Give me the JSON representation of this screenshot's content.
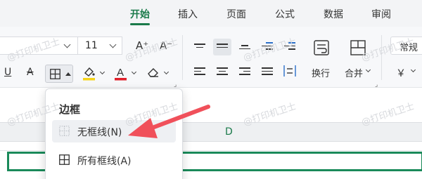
{
  "tabs": [
    {
      "label": "开始",
      "active": true
    },
    {
      "label": "插入"
    },
    {
      "label": "页面"
    },
    {
      "label": "公式"
    },
    {
      "label": "数据"
    },
    {
      "label": "审阅"
    }
  ],
  "ribbon": {
    "font_size": "11",
    "grow_font": "A⁺",
    "shrink_font": "A⁻",
    "underline": "U",
    "strike": "A",
    "wrap_label": "换行",
    "merge_label": "合并",
    "number_format": "常规",
    "currency": "￥"
  },
  "sheet": {
    "column_d": "D"
  },
  "borders_menu": {
    "title": "边框",
    "items": [
      {
        "label": "无框线(N)"
      },
      {
        "label": "所有框线(A)"
      }
    ]
  },
  "watermark": "@打印机卫士",
  "colors": {
    "accent": "#1a7a4a",
    "font_color": "#e0202a",
    "highlight": "#f5d31a",
    "arrow": "#f0505a"
  }
}
